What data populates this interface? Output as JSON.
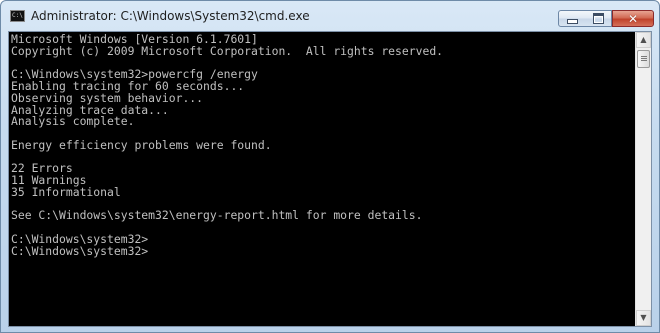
{
  "window": {
    "title": "Administrator: C:\\Windows\\System32\\cmd.exe",
    "app_icon_text": "C:\\",
    "controls": {
      "minimize": "minimize",
      "maximize": "maximize",
      "close": "✕"
    }
  },
  "console": {
    "lines": [
      "Microsoft Windows [Version 6.1.7601]",
      "Copyright (c) 2009 Microsoft Corporation.  All rights reserved.",
      "",
      "C:\\Windows\\system32>powercfg /energy",
      "Enabling tracing for 60 seconds...",
      "Observing system behavior...",
      "Analyzing trace data...",
      "Analysis complete.",
      "",
      "Energy efficiency problems were found.",
      "",
      "22 Errors",
      "11 Warnings",
      "35 Informational",
      "",
      "See C:\\Windows\\system32\\energy-report.html for more details.",
      "",
      "C:\\Windows\\system32>",
      "C:\\Windows\\system32>"
    ],
    "text_color": "#c0c0c0",
    "background_color": "#000000"
  },
  "scrollbar": {
    "up_glyph": "▲",
    "down_glyph": "▼"
  }
}
